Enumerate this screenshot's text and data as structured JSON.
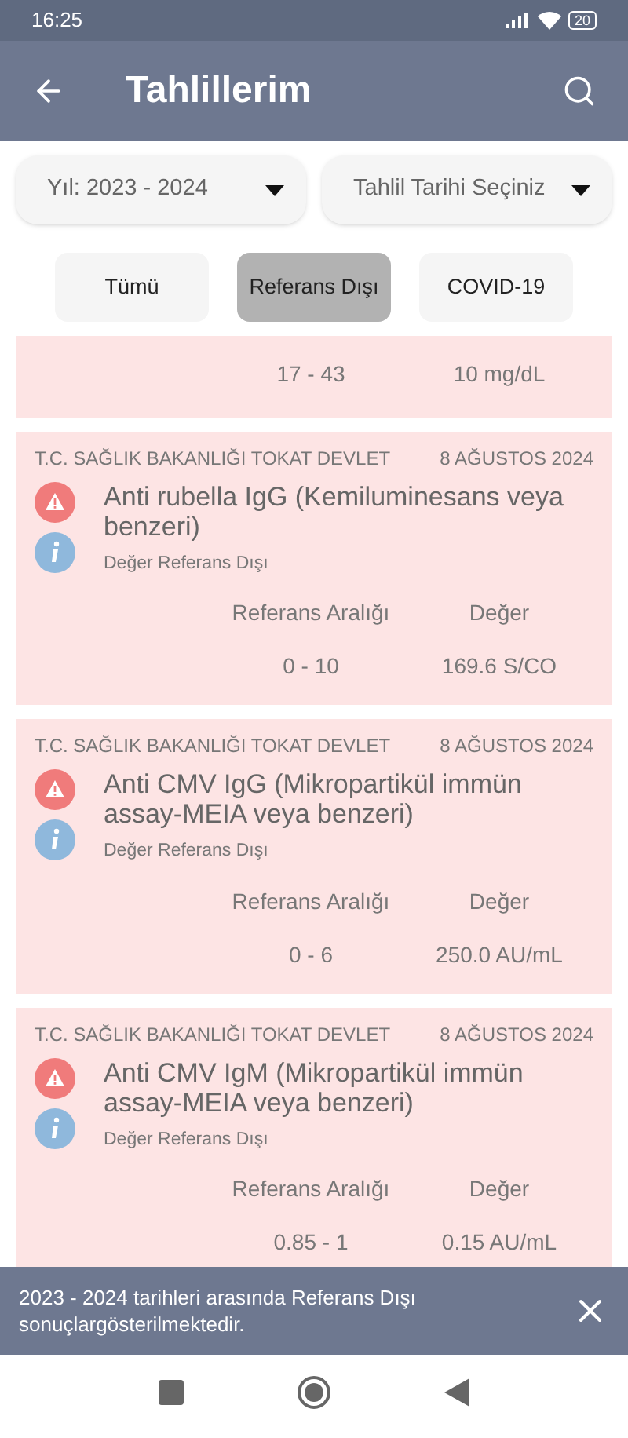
{
  "status_bar": {
    "time": "16:25",
    "battery": "20"
  },
  "app_bar": {
    "title": "Tahlillerim"
  },
  "dropdowns": [
    {
      "value": "Yıl: 2023 - 2024"
    },
    {
      "value": "Tahlil Tarihi Seçiniz"
    }
  ],
  "filters": [
    {
      "label": "Tümü",
      "selected": false
    },
    {
      "label": "Referans Dışı",
      "selected": true
    },
    {
      "label": "COVID-19",
      "selected": false
    }
  ],
  "partial_result": {
    "range": "17 - 43",
    "value": "10 mg/dL"
  },
  "results": [
    {
      "institution": "T.C. SAĞLIK BAKANLIĞI TOKAT DEVLET",
      "date": "8 AĞUSTOS 2024",
      "test": "Anti rubella IgG (Kemiluminesans veya benzeri)",
      "status": "Değer Referans Dışı",
      "range_label": "Referans Aralığı",
      "value_label": "Değer",
      "range": "0 - 10",
      "value": "169.6 S/CO"
    },
    {
      "institution": "T.C. SAĞLIK BAKANLIĞI TOKAT DEVLET",
      "date": "8 AĞUSTOS 2024",
      "test": "Anti CMV IgG (Mikropartikül immün assay-MEIA veya benzeri)",
      "status": "Değer Referans Dışı",
      "range_label": "Referans Aralığı",
      "value_label": "Değer",
      "range": "0 - 6",
      "value": "250.0 AU/mL"
    },
    {
      "institution": "T.C. SAĞLIK BAKANLIĞI TOKAT DEVLET",
      "date": "8 AĞUSTOS 2024",
      "test": "Anti CMV IgM (Mikropartikül immün assay-MEIA veya benzeri)",
      "status": "Değer Referans Dışı",
      "range_label": "Referans Aralığı",
      "value_label": "Değer",
      "range": "0.85 - 1",
      "value": "0.15 AU/mL"
    }
  ],
  "snackbar": {
    "message": "2023 - 2024 tarihleri arasında Referans Dışı sonuçlargösterilmektedir."
  }
}
